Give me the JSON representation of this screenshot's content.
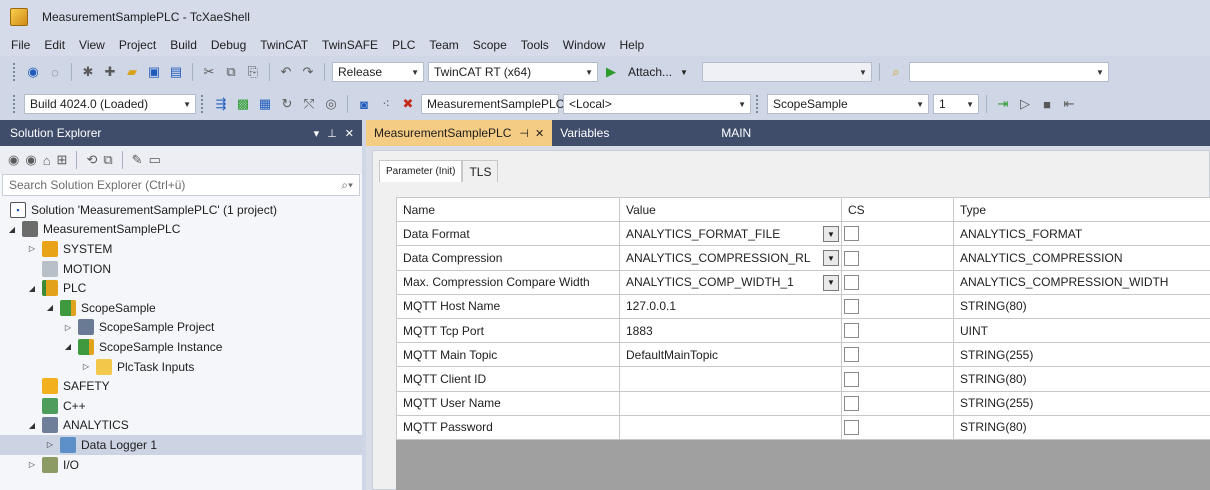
{
  "window": {
    "title": "MeasurementSamplePLC - TcXaeShell"
  },
  "menu": [
    "File",
    "Edit",
    "View",
    "Project",
    "Build",
    "Debug",
    "TwinCAT",
    "TwinSAFE",
    "PLC",
    "Team",
    "Scope",
    "Tools",
    "Window",
    "Help"
  ],
  "toolbar1": {
    "configuration": "Release",
    "platform": "TwinCAT RT (x64)",
    "attach_label": "Attach..."
  },
  "toolbar2": {
    "build_version": "Build 4024.0 (Loaded)",
    "project_target": "MeasurementSamplePLC",
    "target_system": "<Local>",
    "scope_project": "ScopeSample",
    "index": "1"
  },
  "solution_explorer": {
    "title": "Solution Explorer",
    "search_placeholder": "Search Solution Explorer (Ctrl+ü)",
    "tree": [
      {
        "label": "Solution 'MeasurementSamplePLC' (1 project)",
        "icon": "solution-icon"
      },
      {
        "label": "MeasurementSamplePLC",
        "icon": "project-icon"
      },
      {
        "label": "SYSTEM",
        "icon": "system-icon"
      },
      {
        "label": "MOTION",
        "icon": "motion-icon"
      },
      {
        "label": "PLC",
        "icon": "plc-icon"
      },
      {
        "label": "ScopeSample",
        "icon": "plc-project-icon"
      },
      {
        "label": "ScopeSample Project",
        "icon": "project-file-icon"
      },
      {
        "label": "ScopeSample Instance",
        "icon": "plc-instance-icon"
      },
      {
        "label": "PlcTask Inputs",
        "icon": "folder-icon"
      },
      {
        "label": "SAFETY",
        "icon": "safety-icon"
      },
      {
        "label": "C++",
        "icon": "cpp-icon"
      },
      {
        "label": "ANALYTICS",
        "icon": "analytics-icon"
      },
      {
        "label": "Data Logger 1",
        "icon": "data-logger-icon"
      },
      {
        "label": "I/O",
        "icon": "io-icon"
      }
    ]
  },
  "doc_tabs": [
    {
      "label": "MeasurementSamplePLC",
      "active": true
    },
    {
      "label": "Variables",
      "active": false
    },
    {
      "label": "MAIN",
      "active": false
    }
  ],
  "param_tabs": [
    {
      "label": "Parameter (Init)",
      "active": true
    },
    {
      "label": "TLS",
      "active": false
    }
  ],
  "grid": {
    "columns": [
      "Name",
      "Value",
      "CS",
      "Type"
    ],
    "rows": [
      {
        "name": "Data Format",
        "value": "ANALYTICS_FORMAT_FILE",
        "dropdown": true,
        "type": "ANALYTICS_FORMAT"
      },
      {
        "name": "Data Compression",
        "value": "ANALYTICS_COMPRESSION_RL",
        "dropdown": true,
        "type": "ANALYTICS_COMPRESSION"
      },
      {
        "name": "Max. Compression Compare Width",
        "value": "ANALYTICS_COMP_WIDTH_1",
        "dropdown": true,
        "type": "ANALYTICS_COMPRESSION_WIDTH"
      },
      {
        "name": "MQTT Host Name",
        "value": "127.0.0.1",
        "dropdown": false,
        "type": "STRING(80)"
      },
      {
        "name": "MQTT Tcp Port",
        "value": "1883",
        "dropdown": false,
        "type": "UINT"
      },
      {
        "name": "MQTT Main Topic",
        "value": "DefaultMainTopic",
        "dropdown": false,
        "type": "STRING(255)"
      },
      {
        "name": "MQTT Client ID",
        "value": "",
        "dropdown": false,
        "type": "STRING(80)"
      },
      {
        "name": "MQTT User Name",
        "value": "",
        "dropdown": false,
        "type": "STRING(255)"
      },
      {
        "name": "MQTT Password",
        "value": "",
        "dropdown": false,
        "type": "STRING(80)"
      }
    ]
  },
  "colors": {
    "accent_tab": "#f5cc84",
    "header_bg": "#3f4d6b",
    "selection": "#ccd3e3"
  }
}
